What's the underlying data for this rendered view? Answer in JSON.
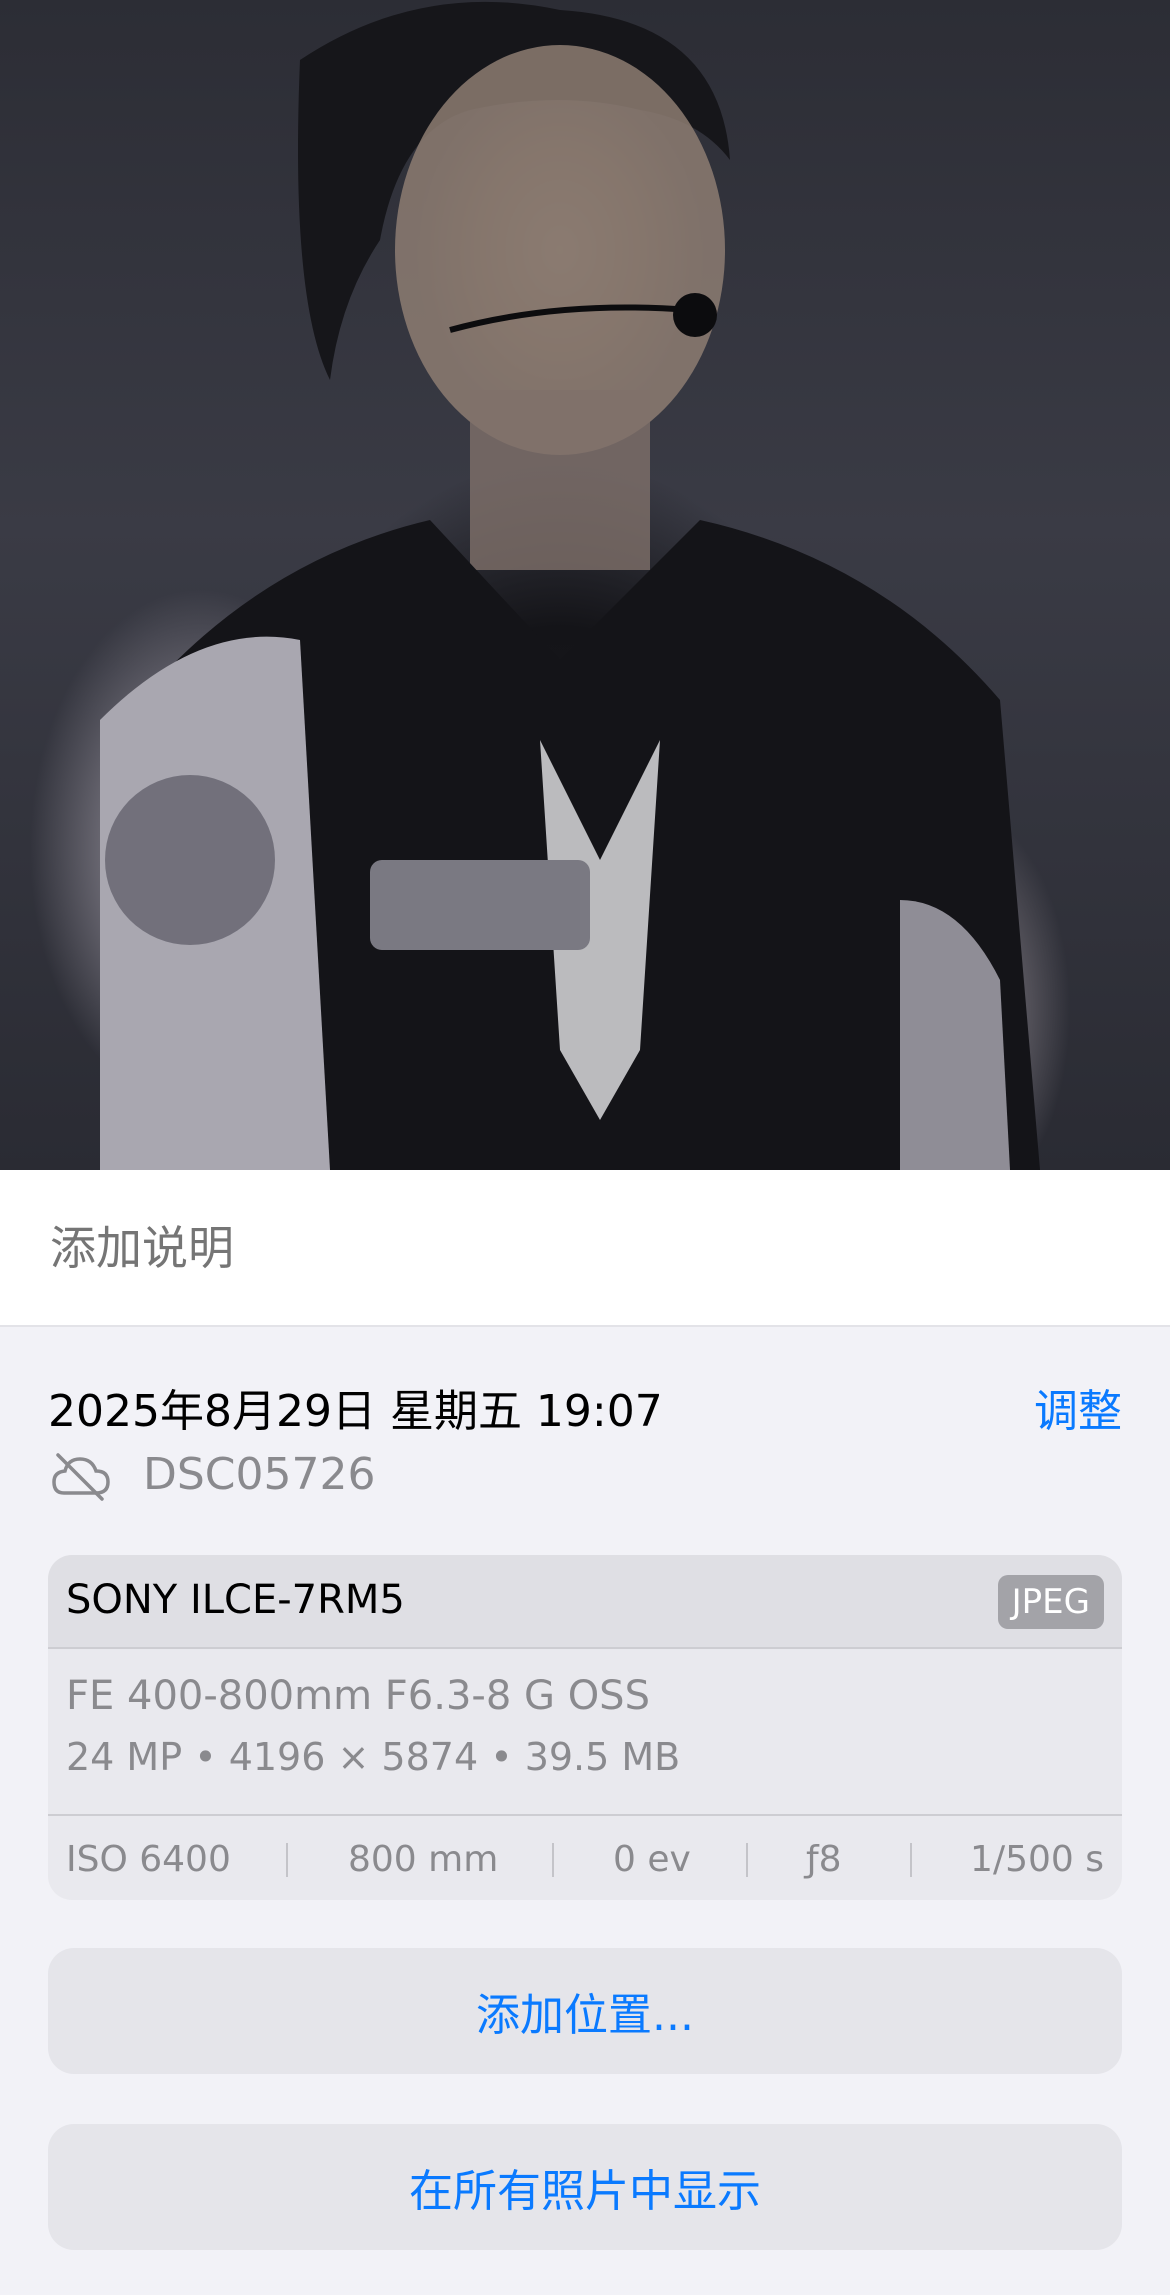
{
  "caption": {
    "placeholder": "添加说明"
  },
  "info": {
    "datetime": "2025年8月29日 星期五 19:07",
    "adjust_label": "调整",
    "filename": "DSC05726"
  },
  "camera": {
    "model": "SONY ILCE-7RM5",
    "format": "JPEG",
    "lens": "FE 400-800mm F6.3-8 G OSS",
    "specs": "24 MP • 4196 × 5874 • 39.5 MB",
    "exif": {
      "iso": "ISO 6400",
      "focal_length": "800 mm",
      "exposure_bias": "0 ev",
      "aperture": "ƒ8",
      "shutter": "1/500 s"
    }
  },
  "actions": {
    "add_location": "添加位置...",
    "show_in_all_photos": "在所有照片中显示"
  },
  "icons": {
    "cloud": "cloud-slash-icon"
  },
  "colors": {
    "accent": "#0a7aff",
    "secondary_text": "#8a8a8e"
  }
}
